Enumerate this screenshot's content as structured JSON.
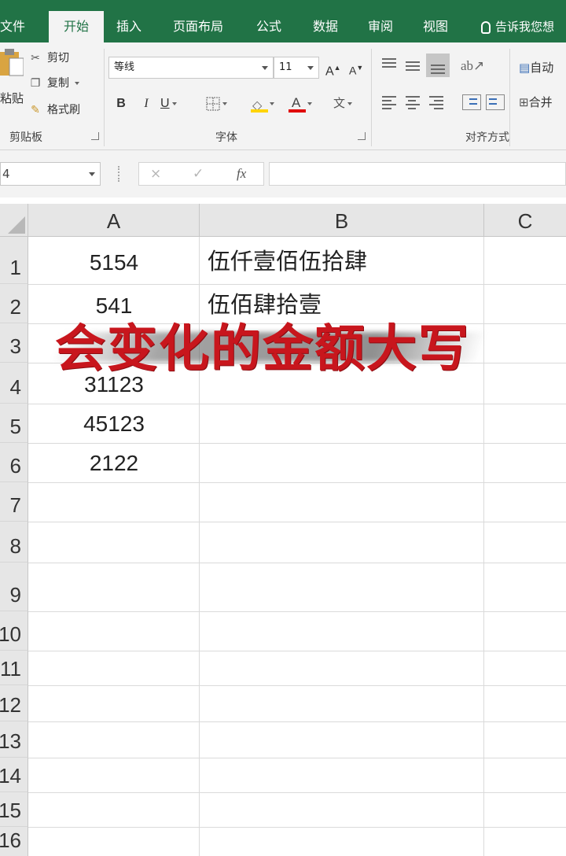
{
  "ribbon_tabs": [
    {
      "label": "文件",
      "active": false
    },
    {
      "label": "开始",
      "active": true
    },
    {
      "label": "插入",
      "active": false
    },
    {
      "label": "页面布局",
      "active": false
    },
    {
      "label": "公式",
      "active": false
    },
    {
      "label": "数据",
      "active": false
    },
    {
      "label": "审阅",
      "active": false
    },
    {
      "label": "视图",
      "active": false
    }
  ],
  "tell_me": "告诉我您想",
  "clipboard": {
    "paste_label": "粘贴",
    "cut_label": "剪切",
    "copy_label": "复制",
    "format_painter_label": "格式刷",
    "group_label": "剪贴板"
  },
  "font": {
    "font_name": "等线",
    "font_size": "11",
    "grow_label": "A",
    "shrink_label": "A",
    "bold_label": "B",
    "italic_label": "I",
    "underline_label": "U",
    "font_color_label": "A",
    "phonetic_label": "文",
    "group_label": "字体"
  },
  "alignment": {
    "wrap_label": "自动",
    "merge_label": "合并",
    "group_label": "对齐方式"
  },
  "formula_bar": {
    "name_box": "4",
    "fx_label": "fx",
    "cancel_icon": "×",
    "enter_icon": "✓",
    "formula": ""
  },
  "columns": [
    "A",
    "B",
    "C"
  ],
  "rows": [
    {
      "num": "1",
      "a": "5154",
      "b": "伍仟壹佰伍拾肆"
    },
    {
      "num": "2",
      "a": "541",
      "b": "伍佰肆拾壹"
    },
    {
      "num": "3",
      "a": "",
      "b": ""
    },
    {
      "num": "4",
      "a": "31123",
      "b": ""
    },
    {
      "num": "5",
      "a": "45123",
      "b": ""
    },
    {
      "num": "6",
      "a": "2122",
      "b": ""
    },
    {
      "num": "7",
      "a": "",
      "b": ""
    },
    {
      "num": "8",
      "a": "",
      "b": ""
    },
    {
      "num": "9",
      "a": "",
      "b": ""
    },
    {
      "num": "10",
      "a": "",
      "b": ""
    },
    {
      "num": "11",
      "a": "",
      "b": ""
    },
    {
      "num": "12",
      "a": "",
      "b": ""
    },
    {
      "num": "13",
      "a": "",
      "b": ""
    },
    {
      "num": "14",
      "a": "",
      "b": ""
    },
    {
      "num": "15",
      "a": "",
      "b": ""
    },
    {
      "num": "16",
      "a": "",
      "b": ""
    }
  ],
  "overlay_caption": "会变化的金额大写",
  "colors": {
    "ribbon_green": "#217346",
    "caption_red": "#c8161d",
    "font_color_bar": "#e00000",
    "fill_color_bar": "#ffd400"
  }
}
